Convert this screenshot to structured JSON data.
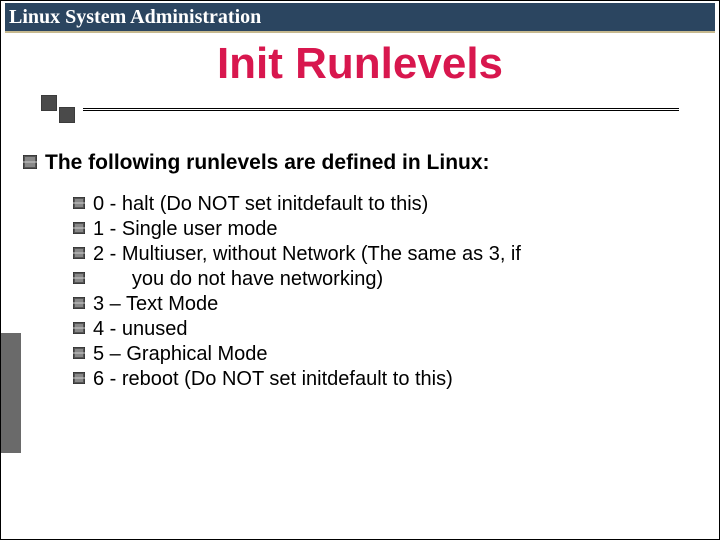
{
  "header": {
    "title": "Linux System Administration"
  },
  "slide": {
    "title": "Init Runlevels",
    "intro": "The following runlevels are defined in Linux:",
    "items": [
      "0 - halt (Do NOT set initdefault to this)",
      "1 - Single user mode",
      "2 - Multiuser, without Network (The same as 3, if",
      "       you do not have networking)",
      "3 – Text Mode",
      "4 - unused",
      "5 – Graphical Mode",
      "6 - reboot (Do NOT set initdefault to this)"
    ]
  },
  "colors": {
    "accent": "#d8174e",
    "header_bg": "#2b4560"
  }
}
